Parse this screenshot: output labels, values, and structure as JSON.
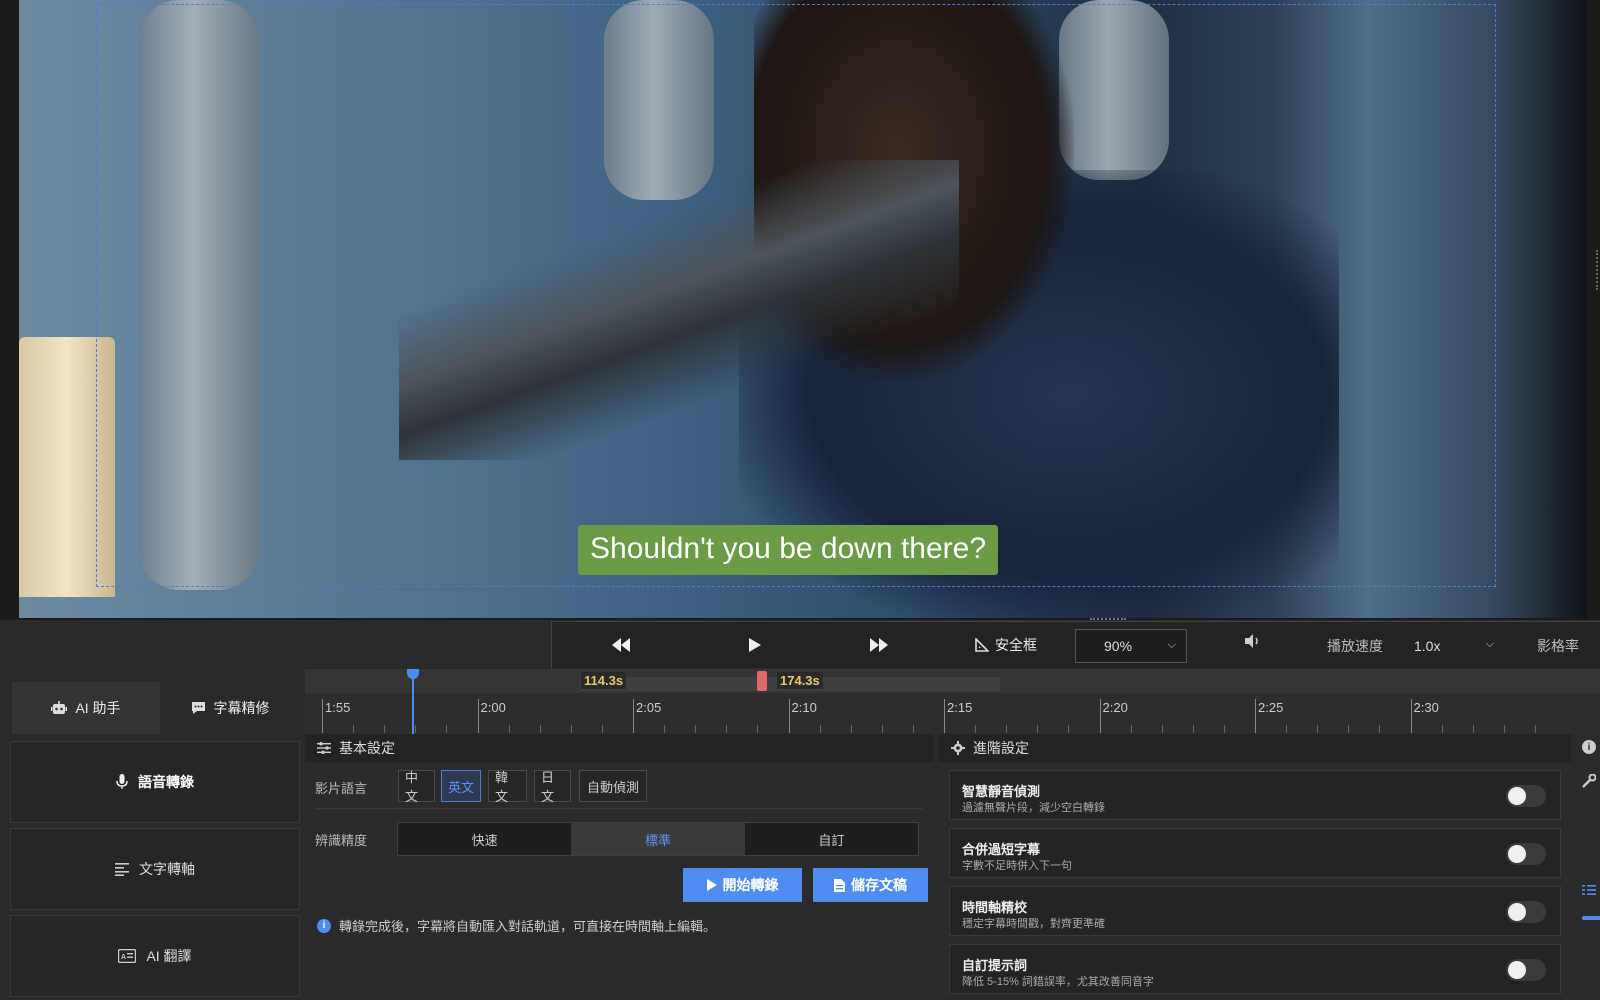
{
  "video": {
    "subtitle": "Shouldn't you be down there?"
  },
  "playback": {
    "rewind_icon": "rewind-icon",
    "play_icon": "play-icon",
    "forward_icon": "fast-forward-icon",
    "safe_frame_label": "安全框",
    "zoom_value": "90%",
    "speed_label": "播放速度",
    "speed_value": "1.0x",
    "fps_label": "影格率"
  },
  "left_tabs": [
    {
      "label": "AI 助手",
      "icon": "robot-icon"
    },
    {
      "label": "字幕精修",
      "icon": "chat-bubble-icon"
    }
  ],
  "sidebar": [
    {
      "label": "語音轉錄",
      "icon": "microphone-icon"
    },
    {
      "label": "文字轉軸",
      "icon": "text-lines-icon"
    },
    {
      "label": "AI 翻譯",
      "icon": "id-card-icon"
    }
  ],
  "timeline": {
    "range_start": "114.3s",
    "range_end": "174.3s",
    "ticks": [
      "1:55",
      "2:00",
      "2:05",
      "2:10",
      "2:15",
      "2:20",
      "2:25",
      "2:30"
    ]
  },
  "basic": {
    "header": "基本設定",
    "language_label": "影片語言",
    "languages": [
      "中文",
      "英文",
      "韓文",
      "日文",
      "自動偵測"
    ],
    "selected_language": "英文",
    "accuracy_label": "辨識精度",
    "accuracy_options": [
      "快速",
      "標準",
      "自訂"
    ],
    "selected_accuracy": "標準",
    "start_button": "開始轉錄",
    "save_button": "儲存文稿",
    "note": "轉錄完成後，字幕將自動匯入對話軌道，可直接在時間軸上編輯。"
  },
  "advanced": {
    "header": "進階設定",
    "items": [
      {
        "title": "智慧靜音偵測",
        "desc": "過濾無聲片段，減少空白轉錄",
        "enabled": false
      },
      {
        "title": "合併過短字幕",
        "desc": "字數不足時併入下一句",
        "enabled": false
      },
      {
        "title": "時間軸精校",
        "desc": "穩定字幕時間戳，對齊更準確",
        "enabled": false
      },
      {
        "title": "自訂提示詞",
        "desc": "降低 5-15% 詞錯誤率，尤其改善同音字",
        "enabled": false
      }
    ]
  },
  "colors": {
    "accent": "#4f8df2",
    "subtitle_bg": "#6b9b47",
    "range_label": "#e8c86a",
    "range_end": "#e06868"
  }
}
